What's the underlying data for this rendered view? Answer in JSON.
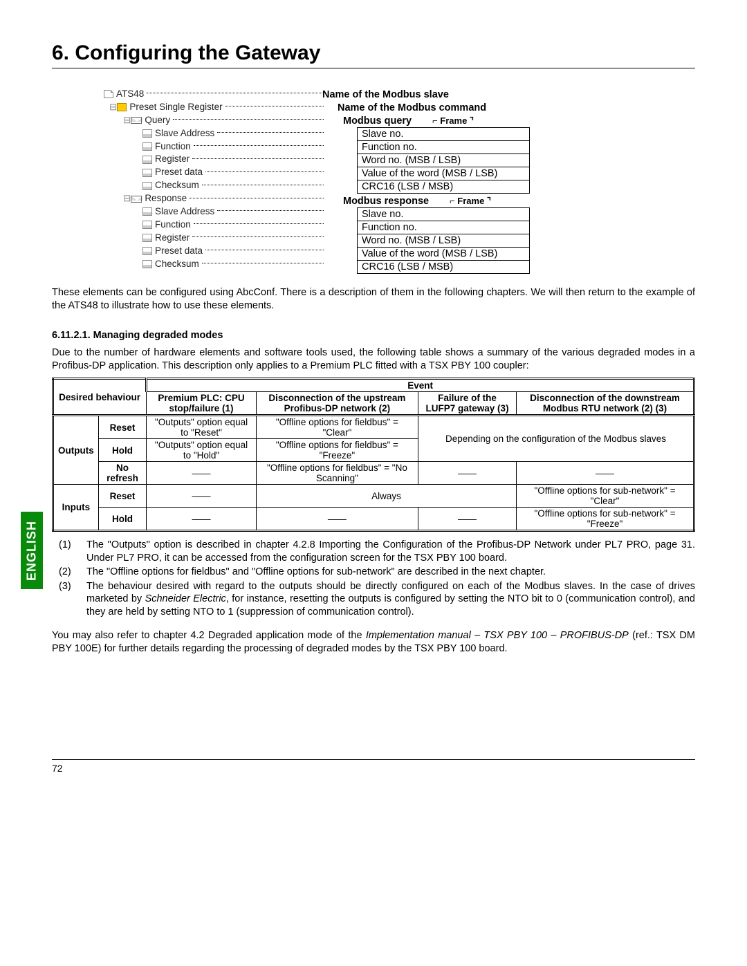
{
  "chapter": {
    "title": "6. Configuring the Gateway"
  },
  "tree": {
    "root": "ATS48",
    "cmd": "Preset Single Register",
    "query": "Query",
    "response": "Response",
    "fields": {
      "slave": "Slave Address",
      "func": "Function",
      "reg": "Register",
      "preset": "Preset data",
      "chk": "Checksum"
    }
  },
  "mapping": {
    "l1": "Name of the Modbus slave",
    "l2": "Name of the Modbus command",
    "q_hdr": "Modbus query",
    "r_hdr": "Modbus response",
    "frame": "⌐ Frame ⌝",
    "rows": {
      "r1": "Slave no.",
      "r2": "Function no.",
      "r3": "Word no. (MSB / LSB)",
      "r4": "Value of the word (MSB / LSB)",
      "r5": "CRC16 (LSB / MSB)"
    }
  },
  "para1": "These elements can be configured using AbcConf. There is a description of them in the following chapters. We will then return to the example of the ATS48 to illustrate how to use these elements.",
  "sub": "6.11.2.1. Managing degraded modes",
  "para2": "Due to the number of hardware elements and software tools used, the following table shows a summary of the various degraded modes in a Profibus-DP application. This description only applies to a Premium PLC fitted with a TSX PBY 100 coupler:",
  "lang": "ENGLISH",
  "tbl": {
    "hdr": {
      "db": "Desired behaviour",
      "ev": "Event",
      "c1": "Premium PLC: CPU stop/failure (1)",
      "c2": "Disconnection of the upstream Profibus-DP network (2)",
      "c3": "Failure of the LUFP7 gateway (3)",
      "c4": "Disconnection of the downstream Modbus RTU network (2) (3)"
    },
    "rows": {
      "outputs": "Outputs",
      "inputs": "Inputs",
      "reset": "Reset",
      "hold": "Hold",
      "norefresh": "No refresh",
      "o_reset_c1": "\"Outputs\" option equal to \"Reset\"",
      "o_reset_c2": "\"Offline options for fieldbus\" = \"Clear\"",
      "o_hold_c1": "\"Outputs\" option equal to \"Hold\"",
      "o_hold_c2": "\"Offline options for fieldbus\" = \"Freeze\"",
      "o_nore_c2": "\"Offline options for fieldbus\" = \"No Scanning\"",
      "o_dep": "Depending on the configuration of the Modbus slaves",
      "i_reset_c23": "Always",
      "i_reset_c4": "\"Offline options for sub-network\" = \"Clear\"",
      "i_hold_c4": "\"Offline options for sub-network\" = \"Freeze\"",
      "dash": "——"
    }
  },
  "notes": {
    "n1": "The \"Outputs\" option is described in chapter 4.2.8 Importing the Configuration of the Profibus-DP Network under PL7 PRO, page 31. Under PL7 PRO, it can be accessed from the configuration screen for the TSX PBY 100 board.",
    "n2": "The \"Offline options for fieldbus\" and \"Offline options for sub-network\" are described in the next chapter.",
    "n3a": "The behaviour desired with regard to the outputs should be directly configured on each of the Modbus slaves. In the case of drives marketed by ",
    "n3b": "Schneider Electric",
    "n3c": ", for instance, resetting the outputs is configured by setting the NTO bit to 0 (communication control), and they are held by setting NTO to 1 (suppression of communication control)."
  },
  "refs": {
    "a": "You may also refer to chapter 4.2 Degraded application mode of the ",
    "b": "Implementation manual – TSX PBY 100 – PROFIBUS-DP",
    "c": " (ref.: TSX DM PBY 100E) for further details regarding the processing of degraded modes by the TSX PBY 100 board."
  },
  "footer": {
    "page": "72"
  }
}
